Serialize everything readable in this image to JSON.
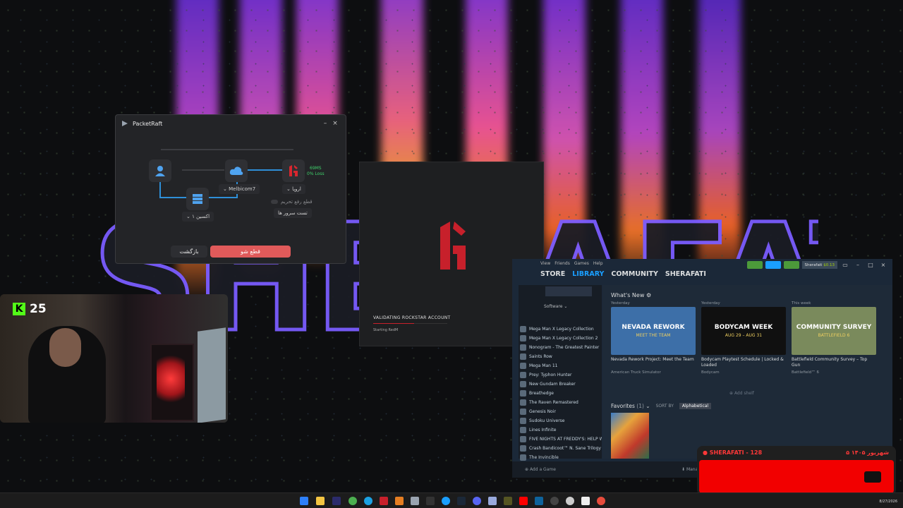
{
  "packetraft": {
    "title": "PacketRaft",
    "minimize": "–",
    "close": "×",
    "server_label": "Melbicom7",
    "region_label": "اروپا",
    "local_label": "اکسین ۱",
    "ping": "69MS",
    "loss": "0% Loss",
    "unblock_toggle": "قطع رفع تحریم",
    "test_servers": "تست سرور ها",
    "back_button": "بازگشت",
    "disconnect_button": "قطع شو",
    "accent": "#e05a5a"
  },
  "rockstar": {
    "status": "VALIDATING ROCKSTAR ACCOUNT",
    "substatus": "Starting RedM",
    "progress_percent": 55,
    "accent": "#c7202b"
  },
  "webcam": {
    "kick_count": "25",
    "kick_color": "#53fc18"
  },
  "steam": {
    "menu": [
      "View",
      "Friends",
      "Games",
      "Help"
    ],
    "nav": [
      "STORE",
      "LIBRARY",
      "COMMUNITY",
      "SHERAFATI"
    ],
    "active_nav": "LIBRARY",
    "username": "Sherafati",
    "balance": "$0.13",
    "sidebar_filter": "Software",
    "games": [
      "Mega Man X Legacy Collection",
      "Mega Man X Legacy Collection 2",
      "Nonogram - The Greatest Painter",
      "Saints Row",
      "Mega Man 11",
      "Prey: Typhon Hunter",
      "New Gundam Breaker",
      "Breathedge",
      "The Raven Remastered",
      "Genesis Noir",
      "Sudoku Universe",
      "Lines Infinite",
      "FIVE NIGHTS AT FREDDY'S: HELP WANTED",
      "Crash Bandicoot™ N. Sane Trilogy",
      "The Invincible"
    ],
    "whats_new": "What's New",
    "cards": [
      {
        "when": "Yesterday",
        "title": "Nevada Rework Project: Meet the Team",
        "game": "American Truck Simulator",
        "color": "#3d6fa8"
      },
      {
        "when": "Yesterday",
        "title": "Bodycam Playtest Schedule | Locked & Loaded",
        "game": "Bodycam",
        "color": "#101010"
      },
      {
        "when": "This week",
        "title": "Battlefield Community Survey – Top Gun",
        "game": "Battlefield™ 6",
        "color": "#7a8a5c"
      }
    ],
    "card_banners": [
      "NEVADA REWORK",
      "BODYCAM WEEK",
      "COMMUNITY SURVEY"
    ],
    "card_sub": [
      "MEET THE TEAM",
      "AUG 29 – AUG 31",
      "BATTLEFIELD 6"
    ],
    "add_shelf": "Add shelf",
    "favorites": "Favorites",
    "favorites_count": "(1)",
    "sort_by": "SORT BY",
    "sort_value": "Alphabetical",
    "add_game": "Add a Game",
    "manage": "Manage"
  },
  "alert": {
    "title": "● SHERAFATI - 128",
    "date": "۵ شهریور ۱۴۰۵"
  },
  "taskbar": {
    "date": "8/27/2026"
  }
}
